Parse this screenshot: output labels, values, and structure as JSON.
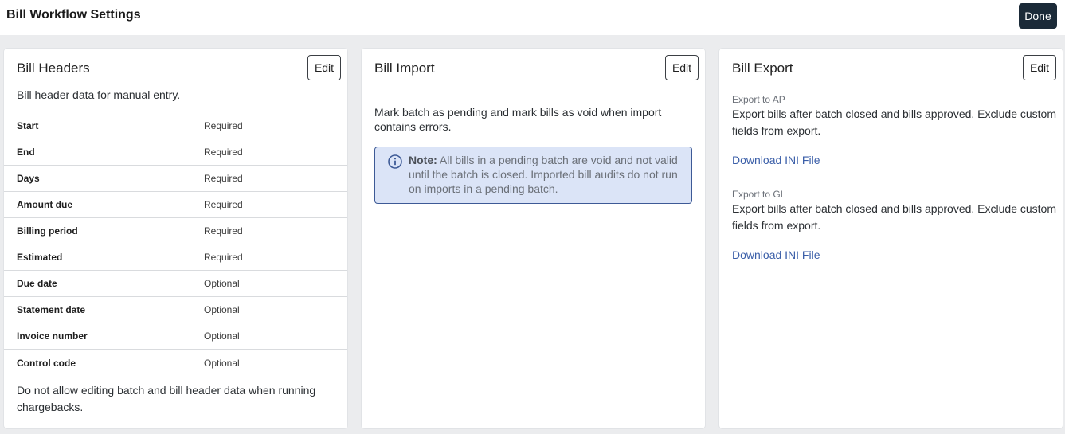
{
  "header": {
    "title": "Bill Workflow Settings",
    "done_label": "Done"
  },
  "bill_headers": {
    "title": "Bill Headers",
    "edit_label": "Edit",
    "description": "Bill header data for manual entry.",
    "rows": [
      {
        "name": "Start",
        "status": "Required"
      },
      {
        "name": "End",
        "status": "Required"
      },
      {
        "name": "Days",
        "status": "Required"
      },
      {
        "name": "Amount due",
        "status": "Required"
      },
      {
        "name": "Billing period",
        "status": "Required"
      },
      {
        "name": "Estimated",
        "status": "Required"
      },
      {
        "name": "Due date",
        "status": "Optional"
      },
      {
        "name": "Statement date",
        "status": "Optional"
      },
      {
        "name": "Invoice number",
        "status": "Optional"
      },
      {
        "name": "Control code",
        "status": "Optional"
      }
    ],
    "footer": "Do not allow editing batch and bill header data when running chargebacks."
  },
  "bill_import": {
    "title": "Bill Import",
    "edit_label": "Edit",
    "description": "Mark batch as pending and mark bills as void when import contains errors.",
    "note_label": "Note:",
    "note_text": "All bills in a pending batch are void and not valid until the batch is closed. Imported bill audits do not run on imports in a pending batch."
  },
  "bill_export": {
    "title": "Bill Export",
    "edit_label": "Edit",
    "sections": [
      {
        "label": "Export to AP",
        "text": "Export bills after batch closed and bills approved. Exclude custom fields from export.",
        "link": "Download INI File"
      },
      {
        "label": "Export to GL",
        "text": "Export bills after batch closed and bills approved. Exclude custom fields from export.",
        "link": "Download INI File"
      }
    ]
  },
  "colors": {
    "done_bg": "#1b2a38",
    "note_bg": "#dbe4f7",
    "note_border": "#3d5a96",
    "link": "#3a5ea8"
  }
}
